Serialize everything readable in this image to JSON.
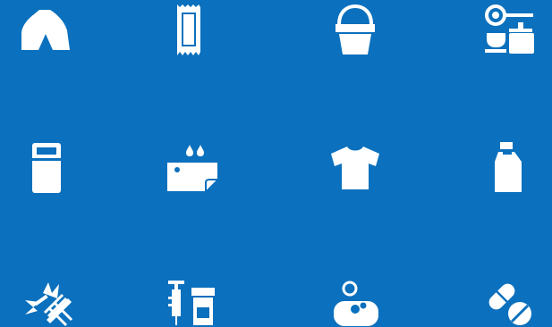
{
  "background_color": "#0b70bd",
  "icon_color": "#ffffff",
  "icons": [
    {
      "name": "tent-icon"
    },
    {
      "name": "towel-icon"
    },
    {
      "name": "bucket-icon"
    },
    {
      "name": "kitchen-set-icon"
    },
    {
      "name": "jerrycan-icon"
    },
    {
      "name": "tarpaulin-icon"
    },
    {
      "name": "t-shirt-icon"
    },
    {
      "name": "detergent-bottle-icon"
    },
    {
      "name": "mosquito-net-icon"
    },
    {
      "name": "syringe-medicine-icon"
    },
    {
      "name": "soap-icon"
    },
    {
      "name": "pills-icon"
    }
  ]
}
